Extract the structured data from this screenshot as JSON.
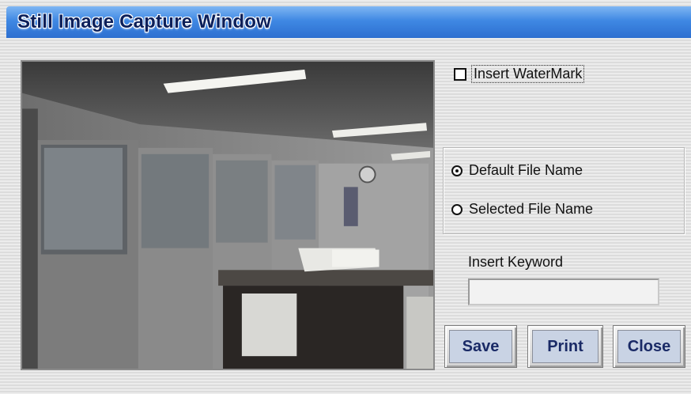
{
  "window": {
    "title": "Still Image Capture Window"
  },
  "preview": {
    "description_icon": "office-scene-image"
  },
  "watermark": {
    "label": "Insert WaterMark",
    "checked": false
  },
  "filename": {
    "options": [
      {
        "label": "Default File Name",
        "selected": true
      },
      {
        "label": "Selected File Name",
        "selected": false
      }
    ]
  },
  "keyword": {
    "label": "Insert Keyword",
    "value": ""
  },
  "buttons": {
    "save": "Save",
    "print": "Print",
    "close": "Close"
  }
}
